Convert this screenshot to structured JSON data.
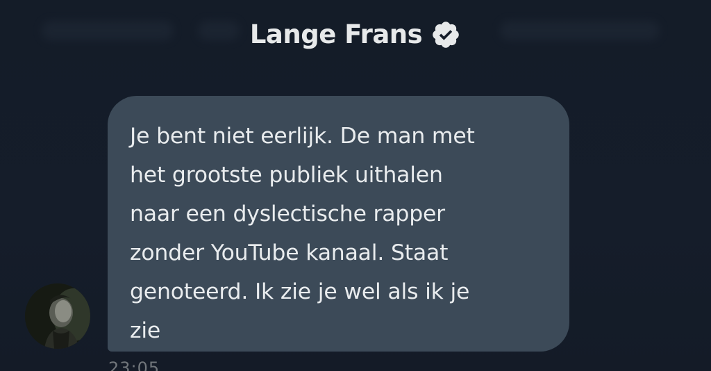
{
  "header": {
    "title": "Lange Frans",
    "verified_icon": "verified-badge-icon"
  },
  "message": {
    "text": "Je bent niet eerlijk. De man met\nhet grootste publiek uithalen\nnaar een dyslectische rapper\nzonder YouTube kanaal. Staat\ngenoteerd. Ik zie je wel als ik je\nzie",
    "timestamp": "23:05"
  },
  "colors": {
    "background": "#151d29",
    "bubble": "#3c4a58",
    "text": "#e9ecee",
    "muted": "#71767b"
  }
}
